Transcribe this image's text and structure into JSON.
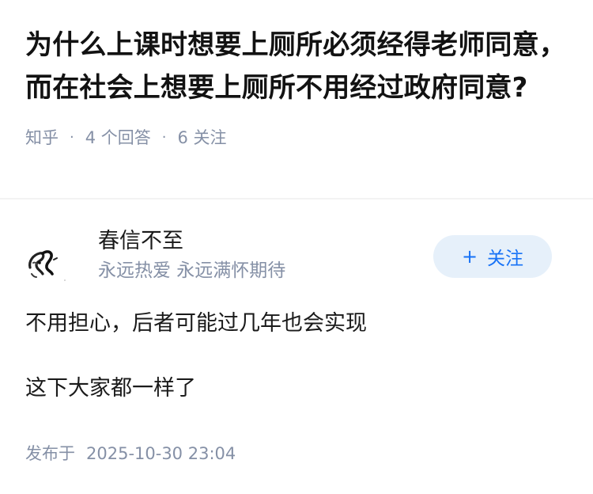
{
  "question": {
    "title": "为什么上课时想要上厕所必须经得老师同意，而在社会上想要上厕所不用经过政府同意?",
    "source": "知乎",
    "answers_count": "4 个回答",
    "followers_count": "6 关注"
  },
  "answer": {
    "author": {
      "name": "春信不至",
      "bio": "永远热爱 永远满怀期待",
      "avatar_icon": "ink-sketch-avatar"
    },
    "follow_button": {
      "plus": "+",
      "label": "关注"
    },
    "paragraphs": [
      "不用担心，后者可能过几年也会实现",
      "这下大家都一样了"
    ],
    "publish_label": "发布于",
    "publish_time": "2025-10-30 23:04"
  },
  "colors": {
    "text": "#1a1a1a",
    "muted": "#8590a6",
    "follow_bg": "#e6f0fa",
    "follow_text": "#1772f6"
  }
}
